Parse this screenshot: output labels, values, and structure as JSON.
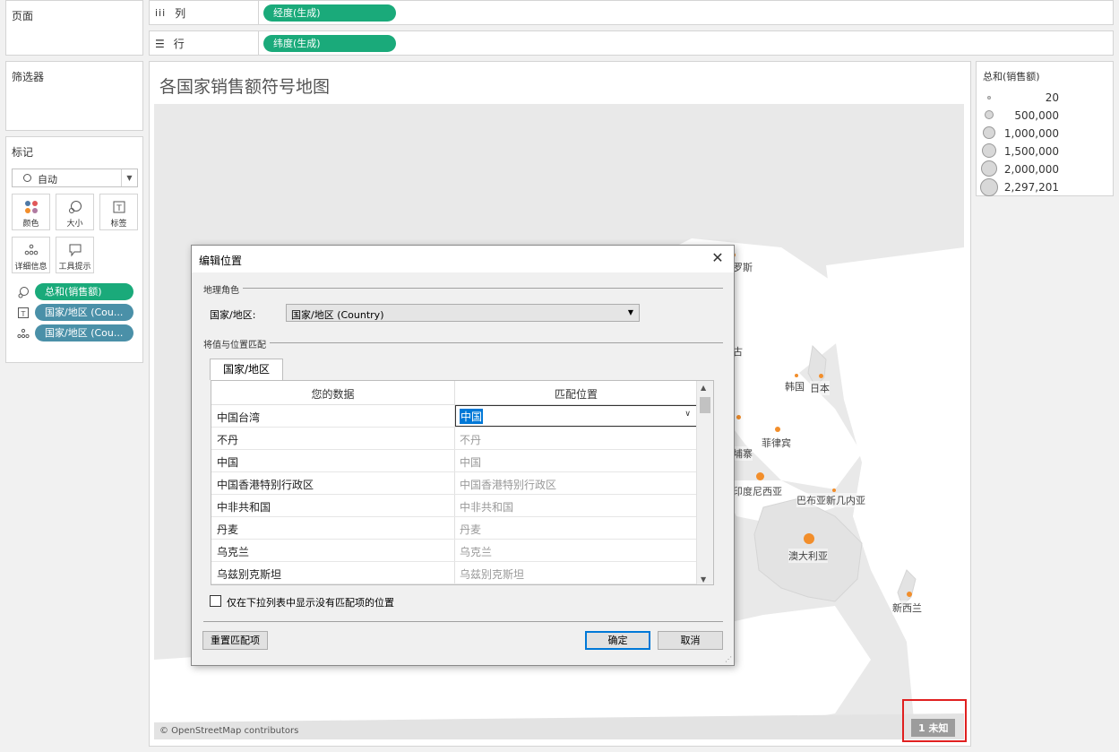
{
  "left": {
    "pages_title": "页面",
    "filters_title": "筛选器",
    "marks_title": "标记",
    "mark_type": "自动",
    "mark_buttons": [
      {
        "label": "颜色",
        "icon": "color-icon"
      },
      {
        "label": "大小",
        "icon": "size-icon"
      },
      {
        "label": "标签",
        "icon": "label-icon"
      },
      {
        "label": "详细信息",
        "icon": "detail-icon"
      },
      {
        "label": "工具提示",
        "icon": "tooltip-icon"
      }
    ],
    "encodings": [
      {
        "icon": "size-icon",
        "label": "总和(销售额)"
      },
      {
        "icon": "label-icon",
        "label": "国家/地区 (Cou..."
      },
      {
        "icon": "detail-icon",
        "label": "国家/地区 (Cou..."
      }
    ]
  },
  "shelves": {
    "columns_label": "列",
    "columns_pill": "经度(生成)",
    "rows_label": "行",
    "rows_pill": "纬度(生成)"
  },
  "map": {
    "title": "各国家销售额符号地图",
    "labels": [
      "罗斯",
      "古",
      "韩国",
      "日本",
      "菲律宾",
      "埔寨",
      "印度尼西亚",
      "巴布亚新几内亚",
      "澳大利亚",
      "新西兰"
    ],
    "credit": "© OpenStreetMap contributors",
    "unknown_badge": "1 未知",
    "colors": {
      "dot": "#f28e2b",
      "land": "#e8e8e8",
      "ocean": "#ffffff"
    }
  },
  "legend": {
    "title": "总和(销售额)",
    "items": [
      "20",
      "500,000",
      "1,000,000",
      "1,500,000",
      "2,000,000",
      "2,297,201"
    ]
  },
  "dialog": {
    "title": "编辑位置",
    "geo_role_group": "地理角色",
    "country_label": "国家/地区:",
    "country_value": "国家/地区 (Country)",
    "match_group": "将值与位置匹配",
    "tab_label": "国家/地区",
    "col_your_data": "您的数据",
    "col_match": "匹配位置",
    "selected_match": "中国",
    "rows": [
      {
        "data": "中国台湾",
        "match": "中国"
      },
      {
        "data": "不丹",
        "match": "不丹"
      },
      {
        "data": "中国",
        "match": "中国"
      },
      {
        "data": "中国香港特别行政区",
        "match": "中国香港特别行政区"
      },
      {
        "data": "中非共和国",
        "match": "中非共和国"
      },
      {
        "data": "丹麦",
        "match": "丹麦"
      },
      {
        "data": "乌克兰",
        "match": "乌克兰"
      },
      {
        "data": "乌兹别克斯坦",
        "match": "乌兹别克斯坦"
      }
    ],
    "checkbox_label": "仅在下拉列表中显示没有匹配项的位置",
    "reset_button": "重置匹配项",
    "ok_button": "确定",
    "cancel_button": "取消"
  }
}
